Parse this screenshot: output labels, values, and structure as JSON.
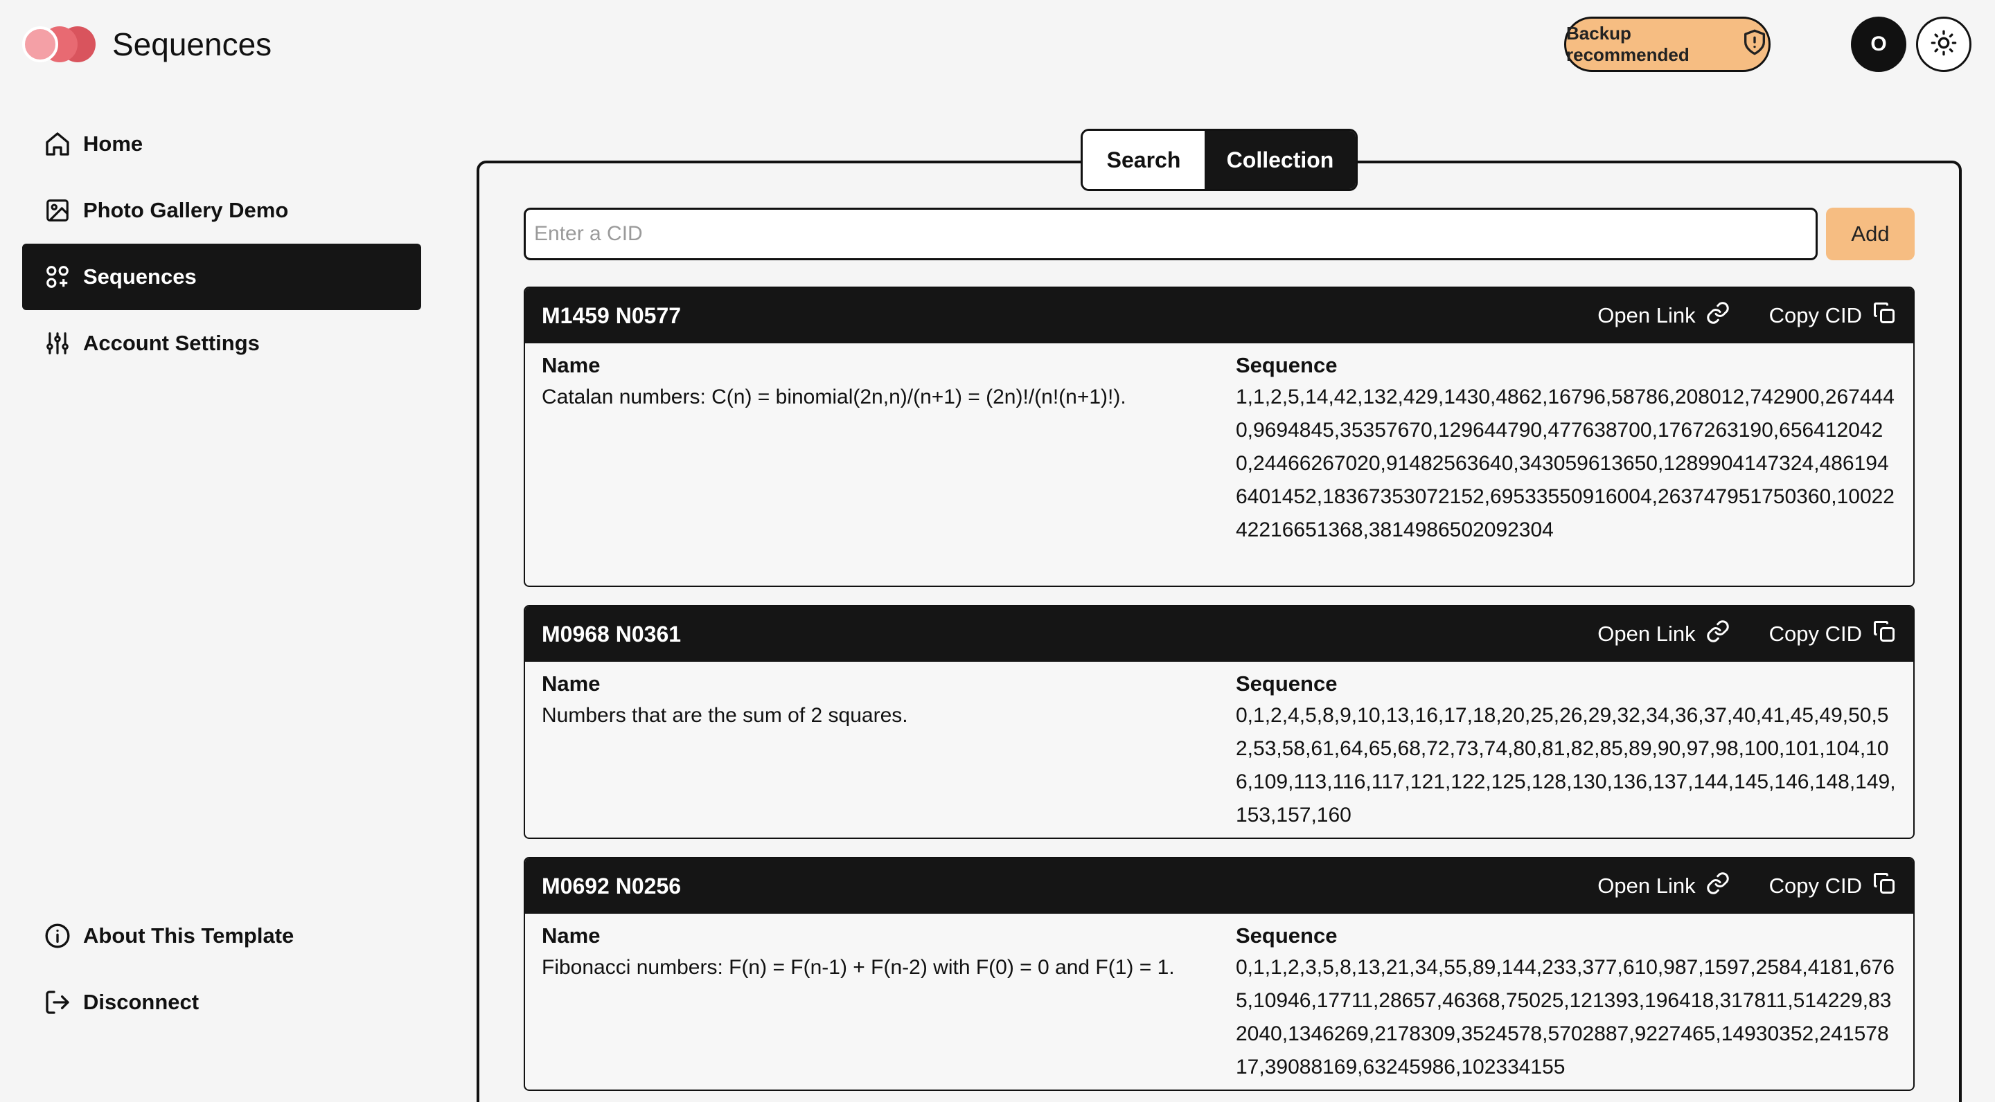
{
  "app": {
    "title": "Sequences",
    "logo_colors": [
      "#f4a0a6",
      "#e86a72",
      "#d9545d"
    ]
  },
  "header": {
    "backup_label": "Backup recommended",
    "avatar_initial": "O"
  },
  "sidebar": {
    "items": [
      {
        "label": "Home",
        "icon": "home-icon"
      },
      {
        "label": "Photo Gallery Demo",
        "icon": "image-icon"
      },
      {
        "label": "Sequences",
        "icon": "apps-icon"
      },
      {
        "label": "Account Settings",
        "icon": "sliders-icon"
      }
    ],
    "bottom_items": [
      {
        "label": "About This Template",
        "icon": "info-icon"
      },
      {
        "label": "Disconnect",
        "icon": "logout-icon"
      }
    ]
  },
  "tabs": {
    "search": "Search",
    "collection": "Collection"
  },
  "cid_form": {
    "placeholder": "Enter a CID",
    "add_label": "Add"
  },
  "card_labels": {
    "open_link": "Open Link",
    "copy_cid": "Copy CID",
    "name": "Name",
    "sequence": "Sequence"
  },
  "sequences": [
    {
      "id": "M1459 N0577",
      "name": "Catalan numbers: C(n) = binomial(2n,n)/(n+1) = (2n)!/(n!(n+1)!).",
      "sequence": "1,1,2,5,14,42,132,429,1430,4862,16796,58786,208012,742900,2674440,9694845,35357670,129644790,477638700,1767263190,6564120420,24466267020,91482563640,343059613650,1289904147324,4861946401452,18367353072152,69533550916004,263747951750360,1002242216651368,3814986502092304"
    },
    {
      "id": "M0968 N0361",
      "name": "Numbers that are the sum of 2 squares.",
      "sequence": "0,1,2,4,5,8,9,10,13,16,17,18,20,25,26,29,32,34,36,37,40,41,45,49,50,52,53,58,61,64,65,68,72,73,74,80,81,82,85,89,90,97,98,100,101,104,106,109,113,116,117,121,122,125,128,130,136,137,144,145,146,148,149,153,157,160"
    },
    {
      "id": "M0692 N0256",
      "name": "Fibonacci numbers: F(n) = F(n-1) + F(n-2) with F(0) = 0 and F(1) = 1.",
      "sequence": "0,1,1,2,3,5,8,13,21,34,55,89,144,233,377,610,987,1597,2584,4181,6765,10946,17711,28657,46368,75025,121393,196418,317811,514229,832040,1346269,2178309,3524578,5702887,9227465,14930352,24157817,39088169,63245986,102334155"
    }
  ]
}
